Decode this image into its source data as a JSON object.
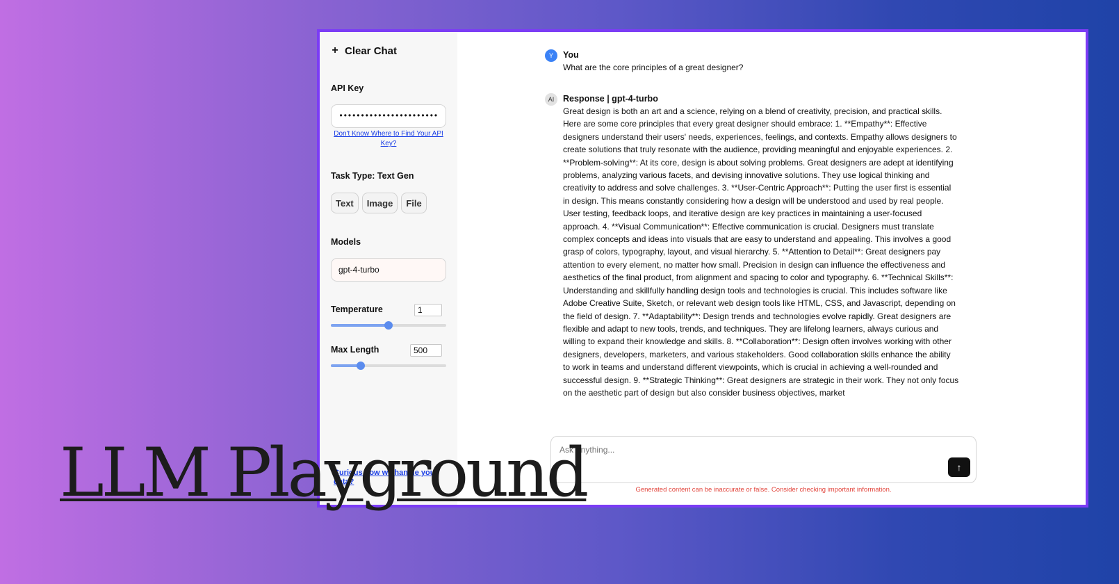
{
  "hero_title": "LLM Playground",
  "sidebar": {
    "clear_chat_label": "Clear Chat",
    "api_key_label": "API Key",
    "api_key_value": "••••••••••••••••••••••••••",
    "api_key_help": "Don't Know Where to Find Your API Key?",
    "task_type_label": "Task Type: Text Gen",
    "task_buttons": [
      "Text",
      "Image",
      "File"
    ],
    "models_label": "Models",
    "model_value": "gpt-4-turbo",
    "temperature_label": "Temperature",
    "temperature_value": "1",
    "temperature_fraction": 0.5,
    "max_length_label": "Max Length",
    "max_length_value": "500",
    "max_length_fraction": 0.26,
    "data_link": "Curious how we handle your data?"
  },
  "chat": {
    "user": {
      "avatar": "Y",
      "name": "You",
      "text": "What are the core principles of a great designer?"
    },
    "response": {
      "avatar": "AI",
      "name": "Response | gpt-4-turbo",
      "text": "Great design is both an art and a science, relying on a blend of creativity, precision, and practical skills. Here are some core principles that every great designer should embrace: 1. **Empathy**: Effective designers understand their users' needs, experiences, feelings, and contexts. Empathy allows designers to create solutions that truly resonate with the audience, providing meaningful and enjoyable experiences. 2. **Problem-solving**: At its core, design is about solving problems. Great designers are adept at identifying problems, analyzing various facets, and devising innovative solutions. They use logical thinking and creativity to address and solve challenges. 3. **User-Centric Approach**: Putting the user first is essential in design. This means constantly considering how a design will be understood and used by real people. User testing, feedback loops, and iterative design are key practices in maintaining a user-focused approach. 4. **Visual Communication**: Effective communication is crucial. Designers must translate complex concepts and ideas into visuals that are easy to understand and appealing. This involves a good grasp of colors, typography, layout, and visual hierarchy. 5. **Attention to Detail**: Great designers pay attention to every element, no matter how small. Precision in design can influence the effectiveness and aesthetics of the final product, from alignment and spacing to color and typography. 6. **Technical Skills**: Understanding and skillfully handling design tools and technologies is crucial. This includes software like Adobe Creative Suite, Sketch, or relevant web design tools like HTML, CSS, and Javascript, depending on the field of design. 7. **Adaptability**: Design trends and technologies evolve rapidly. Great designers are flexible and adapt to new tools, trends, and techniques. They are lifelong learners, always curious and willing to expand their knowledge and skills. 8. **Collaboration**: Design often involves working with other designers, developers, marketers, and various stakeholders. Good collaboration skills enhance the ability to work in teams and understand different viewpoints, which is crucial in achieving a well-rounded and successful design. 9. **Strategic Thinking**: Great designers are strategic in their work. They not only focus on the aesthetic part of design but also consider business objectives, market"
    },
    "input_placeholder": "Ask Anything...",
    "disclaimer": "Generated content can be inaccurate or false. Consider checking important information."
  },
  "colors": {
    "window_border": "#7b3cf5",
    "accent": "#5b8cee",
    "disclaimer": "#e2453c",
    "link": "#1a3ee6"
  },
  "icons": {
    "clear_chat": "plus-icon",
    "send": "arrow-up-icon"
  }
}
